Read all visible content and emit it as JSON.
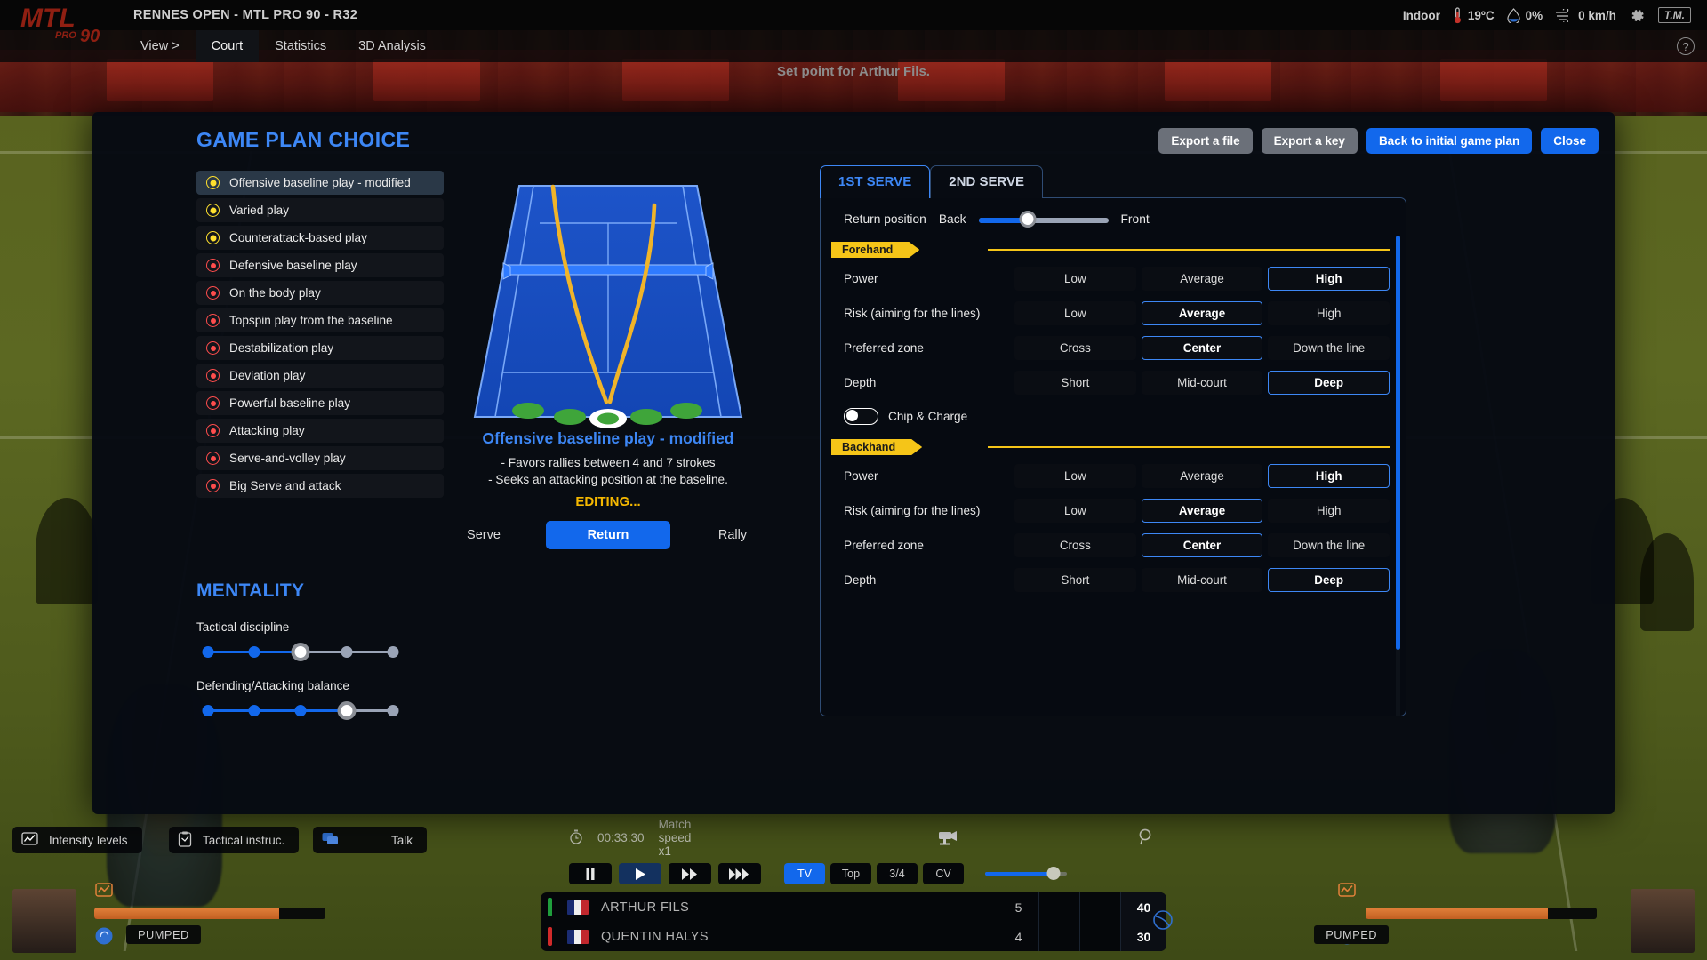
{
  "topbar": {
    "match_title": "RENNES OPEN - MTL PRO 90 - R32",
    "logo_main": "MTL",
    "logo_pro": "PRO",
    "logo_90": "90",
    "conditions": {
      "venue": "Indoor",
      "temperature": "19ºC",
      "humidity": "0%",
      "wind": "0 km/h"
    },
    "brand_badge": "T.M.",
    "help": "?"
  },
  "nav": {
    "items": [
      {
        "label": "View >",
        "active": false
      },
      {
        "label": "Court",
        "active": true
      },
      {
        "label": "Statistics",
        "active": false
      },
      {
        "label": "3D Analysis",
        "active": false
      }
    ]
  },
  "banner": {
    "text": "Set point for Arthur Fils."
  },
  "modal": {
    "title": "GAME PLAN CHOICE",
    "actions": [
      {
        "label": "Export a file",
        "style": "grey"
      },
      {
        "label": "Export a key",
        "style": "grey"
      },
      {
        "label": "Back to initial game plan",
        "style": "blue"
      },
      {
        "label": "Close",
        "style": "blue"
      }
    ]
  },
  "game_plans": [
    {
      "label": "Offensive baseline play - modified",
      "marker": "yellow",
      "selected": true
    },
    {
      "label": "Varied play",
      "marker": "yellow",
      "selected": false
    },
    {
      "label": "Counterattack-based play",
      "marker": "yellow",
      "selected": false
    },
    {
      "label": "Defensive baseline play",
      "marker": "red",
      "selected": false
    },
    {
      "label": "On the body play",
      "marker": "red",
      "selected": false
    },
    {
      "label": "Topspin play from the baseline",
      "marker": "red",
      "selected": false
    },
    {
      "label": "Destabilization play",
      "marker": "red",
      "selected": false
    },
    {
      "label": "Deviation play",
      "marker": "red",
      "selected": false
    },
    {
      "label": "Powerful baseline play",
      "marker": "red",
      "selected": false
    },
    {
      "label": "Attacking play",
      "marker": "red",
      "selected": false
    },
    {
      "label": "Serve-and-volley play",
      "marker": "red",
      "selected": false
    },
    {
      "label": "Big Serve and attack",
      "marker": "red",
      "selected": false
    }
  ],
  "mentality": {
    "title": "MENTALITY",
    "sliders": [
      {
        "label": "Tactical discipline",
        "steps": 5,
        "value": 3
      },
      {
        "label": "Defending/Attacking balance",
        "steps": 5,
        "value": 4
      }
    ]
  },
  "center": {
    "plan_name": "Offensive baseline play - modified",
    "description_line_1": "- Favors rallies between 4 and 7 strokes",
    "description_line_2": "- Seeks an attacking position at the baseline.",
    "editing_status": "EDITING...",
    "phase_tabs": [
      {
        "label": "Serve",
        "active": false
      },
      {
        "label": "Return",
        "active": true
      },
      {
        "label": "Rally",
        "active": false
      }
    ]
  },
  "right_panel": {
    "serve_tabs": [
      {
        "label": "1ST SERVE",
        "active": true
      },
      {
        "label": "2ND SERVE",
        "active": false
      }
    ],
    "return_position": {
      "label": "Return position",
      "min_label": "Back",
      "max_label": "Front",
      "value_pct": 38
    },
    "wings": [
      {
        "name": "Forehand",
        "rows": [
          {
            "label": "Power",
            "options": [
              "Low",
              "Average",
              "High"
            ],
            "selected": 2
          },
          {
            "label": "Risk (aiming for the lines)",
            "options": [
              "Low",
              "Average",
              "High"
            ],
            "selected": 1
          },
          {
            "label": "Preferred zone",
            "options": [
              "Cross",
              "Center",
              "Down the line"
            ],
            "selected": 1
          },
          {
            "label": "Depth",
            "options": [
              "Short",
              "Mid-court",
              "Deep"
            ],
            "selected": 2
          }
        ],
        "toggle": {
          "label": "Chip & Charge",
          "on": false
        }
      },
      {
        "name": "Backhand",
        "rows": [
          {
            "label": "Power",
            "options": [
              "Low",
              "Average",
              "High"
            ],
            "selected": 2
          },
          {
            "label": "Risk (aiming for the lines)",
            "options": [
              "Low",
              "Average",
              "High"
            ],
            "selected": 1
          },
          {
            "label": "Preferred zone",
            "options": [
              "Cross",
              "Center",
              "Down the line"
            ],
            "selected": 1
          },
          {
            "label": "Depth",
            "options": [
              "Short",
              "Mid-court",
              "Deep"
            ],
            "selected": 2
          }
        ],
        "toggle": null
      }
    ]
  },
  "hud": {
    "left_buttons": [
      {
        "label": "Intensity levels",
        "icon": "intensity-icon"
      },
      {
        "label": "Tactical instruc.",
        "icon": "clipboard-icon"
      },
      {
        "label": "Talk",
        "icon": "chat-icon"
      }
    ],
    "clock": "00:33:30",
    "match_speed": "Match speed x1",
    "transport": [
      {
        "icon": "pause-icon",
        "active": false
      },
      {
        "icon": "play-icon",
        "active": true
      },
      {
        "icon": "fast-forward-icon",
        "active": false
      },
      {
        "icon": "very-fast-forward-icon",
        "active": false
      }
    ],
    "camera_tabs": [
      {
        "label": "TV",
        "active": true
      },
      {
        "label": "Top",
        "active": false
      },
      {
        "label": "3/4",
        "active": false
      },
      {
        "label": "CV",
        "active": false
      }
    ],
    "score": {
      "rows": [
        {
          "name": "ARTHUR FILS",
          "accent": "#1f9e3c",
          "sets": [
            "5",
            "",
            ""
          ],
          "points": "40"
        },
        {
          "name": "QUENTIN HALYS",
          "accent": "#d02a2a",
          "sets": [
            "4",
            "",
            ""
          ],
          "points": "30"
        }
      ]
    },
    "players": [
      {
        "mood": "PUMPED",
        "stamina_pct": 80
      },
      {
        "mood": "PUMPED",
        "stamina_pct": 79
      }
    ]
  },
  "colors": {
    "accent_blue": "#3d87f5",
    "button_blue": "#1268ec",
    "highlight_yellow": "#f5c518",
    "marker_red": "#ff4d4d",
    "marker_yellow": "#ffe02e"
  }
}
